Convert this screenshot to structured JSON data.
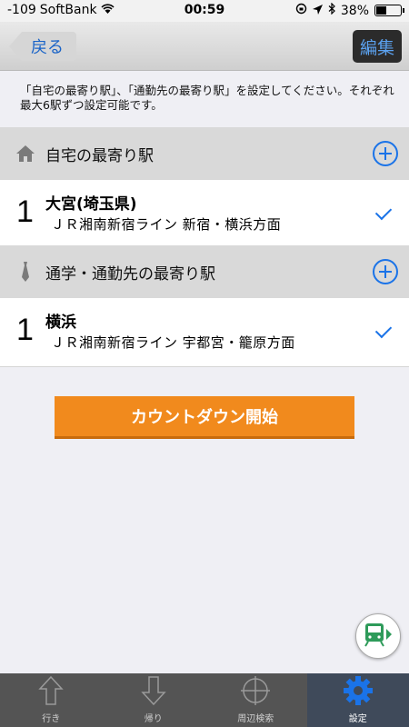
{
  "status_bar": {
    "signal": "-109",
    "carrier": "SoftBank",
    "time": "00:59",
    "battery": "38%",
    "battery_level": 0.38
  },
  "nav": {
    "back_label": "戻る",
    "edit_label": "編集"
  },
  "description": "「自宅の最寄り駅」、「通勤先の最寄り駅」を設定してください。それぞれ最大6駅ずつ設定可能です。",
  "sections": [
    {
      "icon": "house-icon",
      "title": "自宅の最寄り駅",
      "stations": [
        {
          "index": "1",
          "name": "大宮(埼玉県)",
          "line": "ＪＲ湘南新宿ライン 新宿・横浜方面"
        }
      ]
    },
    {
      "icon": "necktie-icon",
      "title": "通学・通勤先の最寄り駅",
      "stations": [
        {
          "index": "1",
          "name": "横浜",
          "line": "ＪＲ湘南新宿ライン 宇都宮・籠原方面"
        }
      ]
    }
  ],
  "countdown_label": "カウントダウン開始",
  "tabs": [
    {
      "label": "行き",
      "icon": "arrow-up-icon",
      "active": false
    },
    {
      "label": "帰り",
      "icon": "arrow-down-icon",
      "active": false
    },
    {
      "label": "周辺検索",
      "icon": "crosshair-icon",
      "active": false
    },
    {
      "label": "設定",
      "icon": "gear-icon",
      "active": true
    }
  ],
  "colors": {
    "accent": "#1a73e8",
    "countdown": "#f18a1d",
    "tabbar": "#545454",
    "train": "#2e9b5a"
  }
}
